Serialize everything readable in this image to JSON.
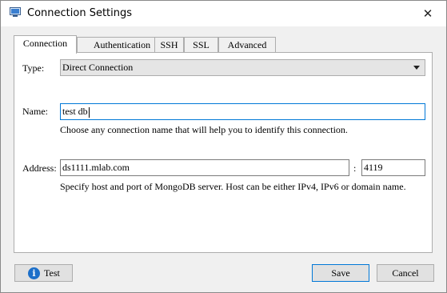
{
  "window": {
    "title": "Connection Settings",
    "close_glyph": "✕",
    "icons": {
      "app": "window-app-icon",
      "close": "close-icon"
    }
  },
  "tabs": [
    {
      "label": "Connection",
      "active": true
    },
    {
      "label": "Authentication",
      "active": false
    },
    {
      "label": "SSH",
      "active": false
    },
    {
      "label": "SSL",
      "active": false
    },
    {
      "label": "Advanced",
      "active": false
    }
  ],
  "connection": {
    "type_label": "Type:",
    "type_value": "Direct Connection",
    "name_label": "Name:",
    "name_value": "test db",
    "name_hint": "Choose any connection name that will help you to identify this connection.",
    "address_label": "Address:",
    "host_value": "ds1111.mlab.com",
    "port_separator": ":",
    "port_value": "4119",
    "address_hint": "Specify host and port of MongoDB server. Host can be either IPv4, IPv6 or domain name."
  },
  "footer": {
    "test_label": "Test",
    "test_icon_glyph": "i",
    "save_label": "Save",
    "cancel_label": "Cancel"
  },
  "colors": {
    "focus_border": "#0078d7",
    "info_icon": "#1c6fc9",
    "dialog_bg": "#f0f0f0"
  }
}
